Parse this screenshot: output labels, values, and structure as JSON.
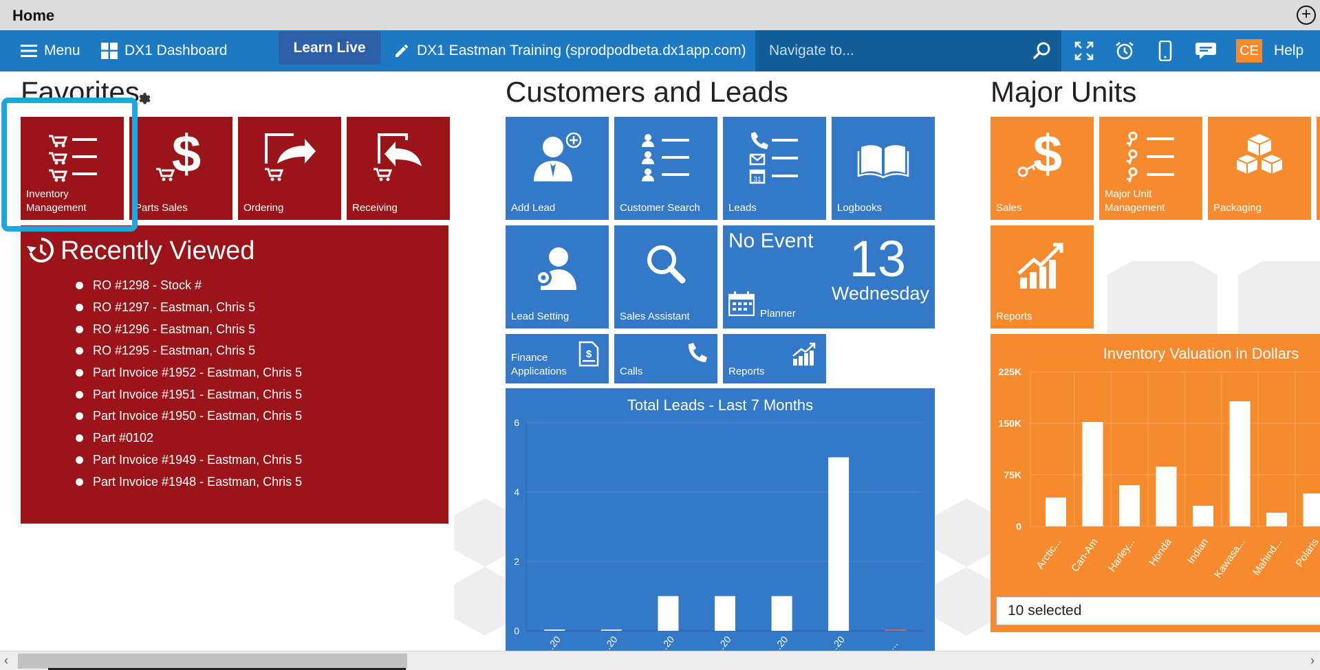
{
  "window": {
    "title": "Home"
  },
  "navbar": {
    "menu_label": "Menu",
    "dashboard_label": "DX1 Dashboard",
    "learn_live_label": "Learn Live",
    "site_label": "DX1 Eastman Training (sprodpodbeta.dx1app.com)",
    "search_placeholder": "Navigate to...",
    "user_initials": "CE",
    "help_label": "Help"
  },
  "favorites": {
    "title": "Favorites",
    "tiles": [
      {
        "label": "Inventory\nManagement",
        "icon": "cart-list-icon"
      },
      {
        "label": "Parts Sales",
        "icon": "dollar-cart-icon"
      },
      {
        "label": "Ordering",
        "icon": "cart-send-icon"
      },
      {
        "label": "Receiving",
        "icon": "cart-receive-icon"
      }
    ]
  },
  "recently_viewed": {
    "title": "Recently Viewed",
    "items": [
      "RO #1298 - Stock #",
      "RO #1297 - Eastman, Chris 5",
      "RO #1296 - Eastman, Chris 5",
      "RO #1295 - Eastman, Chris 5",
      "Part Invoice #1952 - Eastman, Chris 5",
      "Part Invoice #1951 - Eastman, Chris 5",
      "Part Invoice #1950 - Eastman, Chris 5",
      "Part #0102",
      "Part Invoice #1949 - Eastman, Chris 5",
      "Part Invoice #1948 - Eastman, Chris 5"
    ]
  },
  "customers": {
    "title": "Customers and Leads",
    "tiles": {
      "add_lead": "Add Lead",
      "customer_search": "Customer Search",
      "leads": "Leads",
      "logbooks": "Logbooks",
      "lead_setting": "Lead Setting",
      "sales_assistant": "Sales Assistant",
      "finance": "Finance\nApplications",
      "calls": "Calls",
      "reports": "Reports"
    },
    "event": {
      "status": "No Event",
      "day": "13",
      "weekday": "Wednesday",
      "planner": "Planner"
    }
  },
  "major_units": {
    "title": "Major Units",
    "tiles": {
      "sales": "Sales",
      "mu_management": "Major Unit\nManagement",
      "packaging": "Packaging",
      "reports": "Reports"
    },
    "selector_value": "10 selected"
  },
  "chart_data": [
    {
      "type": "bar",
      "title": "Total Leads - Last 7 Months",
      "categories": [
        "…20",
        "…20",
        "…20",
        "…20",
        "…20",
        "…20",
        "…"
      ],
      "values": [
        0,
        0,
        1,
        1,
        1,
        5,
        0
      ],
      "ylim": [
        0,
        6
      ],
      "yticks": [
        0,
        2,
        4,
        6
      ],
      "colors": {
        "bar": "#ffffff",
        "zero_marker_last": "#e06060"
      }
    },
    {
      "type": "bar",
      "title": "Inventory Valuation in Dollars",
      "categories": [
        "Arctic...",
        "Can-Am",
        "Harley...",
        "Honda",
        "Indian",
        "Kawasa...",
        "Mahind...",
        "Polaris"
      ],
      "values": [
        42000,
        152000,
        60000,
        87000,
        30000,
        182000,
        20000,
        48000
      ],
      "ylim": [
        0,
        225000
      ],
      "ytick_labels": [
        "0",
        "75K",
        "150K",
        "225K"
      ],
      "colors": {
        "bar": "#ffffff"
      }
    }
  ],
  "colors": {
    "nav_blue": "#1d7ac2",
    "tile_red": "#9b1419",
    "tile_blue": "#3478c8",
    "tile_orange": "#f58a2e",
    "highlight": "#1fa6dc"
  }
}
